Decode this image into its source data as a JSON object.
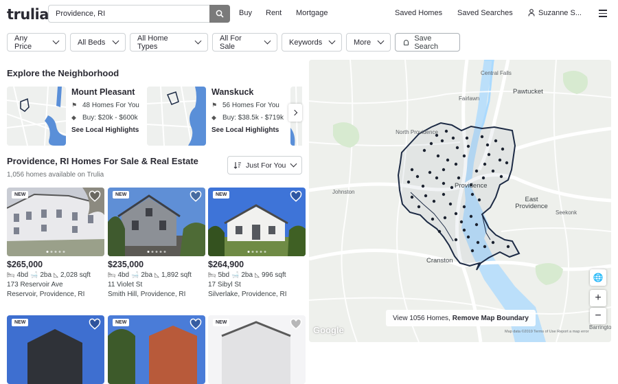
{
  "header": {
    "logo": "trulia",
    "search_value": "Providence, RI",
    "nav": [
      "Buy",
      "Rent",
      "Mortgage"
    ],
    "saved_homes": "Saved Homes",
    "saved_searches": "Saved Searches",
    "user": "Suzanne S..."
  },
  "filters": {
    "items": [
      "Any Price",
      "All Beds",
      "All Home Types",
      "All For Sale",
      "Keywords",
      "More"
    ],
    "save_search": "Save Search"
  },
  "neighborhood": {
    "heading": "Explore the Neighborhood",
    "cards": [
      {
        "name": "Mount Pleasant",
        "homes": "48 Homes For You",
        "buy": "Buy: $20k - $600k",
        "highlights": "See Local Highlights"
      },
      {
        "name": "Wanskuck",
        "homes": "56 Homes For You",
        "buy": "Buy: $38.5k - $719k",
        "highlights": "See Local Highlights"
      }
    ]
  },
  "results": {
    "heading": "Providence, RI Homes For Sale & Real Estate",
    "count": "1,056 homes available on Trulia",
    "sort_label": "Just For You"
  },
  "listings": [
    {
      "badge": "NEW",
      "price": "$265,000",
      "beds": "4bd",
      "baths": "2ba",
      "sqft": "2,028 sqft",
      "street": "173 Reservoir Ave",
      "area": "Reservoir, Providence, RI"
    },
    {
      "badge": "NEW",
      "price": "$235,000",
      "beds": "4bd",
      "baths": "2ba",
      "sqft": "1,892 sqft",
      "street": "11 Violet St",
      "area": "Smith Hill, Providence, RI"
    },
    {
      "badge": "NEW",
      "price": "$264,900",
      "beds": "5bd",
      "baths": "2ba",
      "sqft": "996 sqft",
      "street": "17 Sibyl St",
      "area": "Silverlake, Providence, RI"
    },
    {
      "badge": "NEW"
    },
    {
      "badge": "NEW"
    },
    {
      "badge": "NEW"
    }
  ],
  "map": {
    "labels": [
      "Central Falls",
      "Pawtucket",
      "Fairlawn",
      "North Providence",
      "Providence",
      "Johnston",
      "East Providence",
      "Seekonk",
      "Cranston",
      "Barrington"
    ],
    "view_button": "View 1056 Homes,",
    "remove_boundary": "Remove Map Boundary",
    "attribution": "Map data ©2019   Terms of Use   Report a map error",
    "google": "Google",
    "zoom_in": "+",
    "zoom_out": "−"
  },
  "colors": {
    "accent": "#3b4144",
    "boundary": "#1c2a44",
    "dot": "#1c2330",
    "water": "#aadaff"
  }
}
